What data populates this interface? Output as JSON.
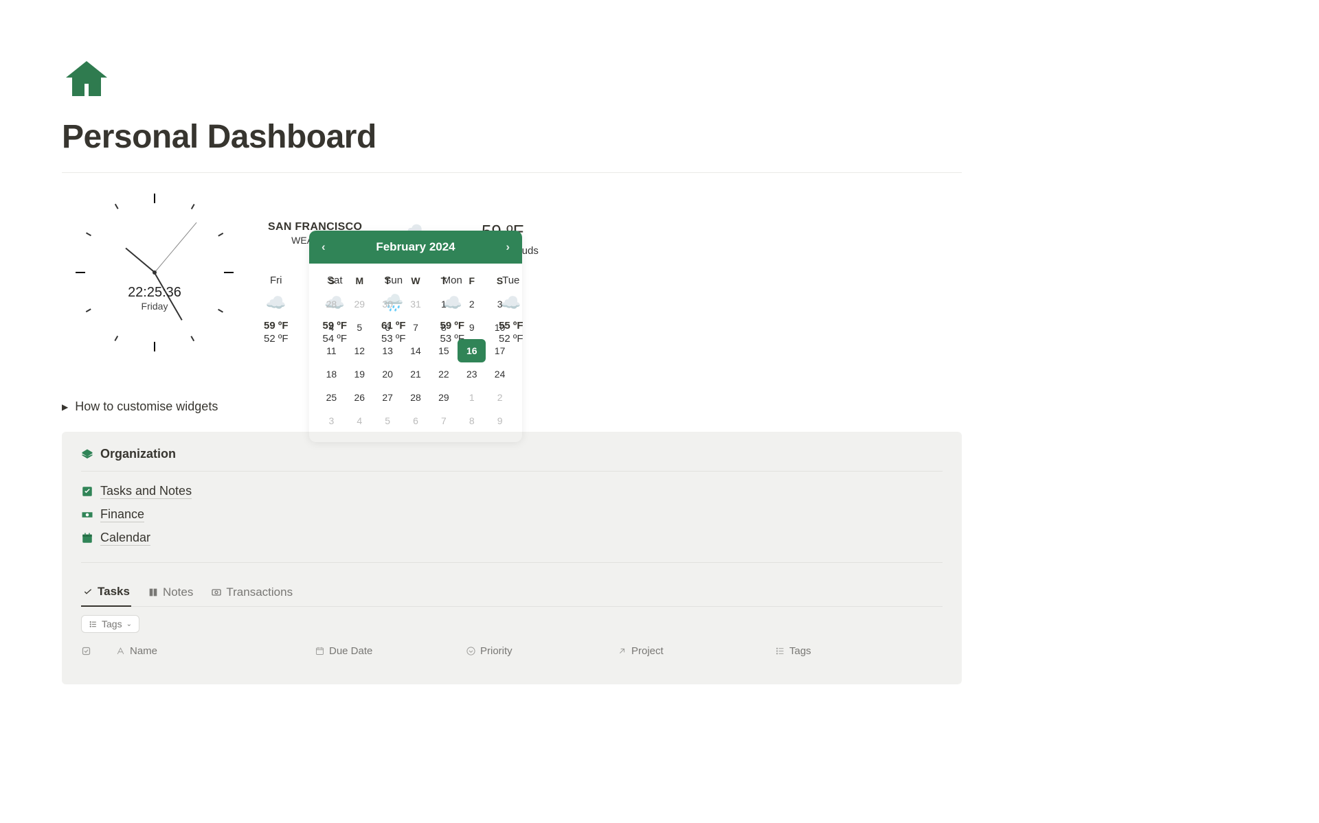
{
  "page": {
    "title": "Personal Dashboard"
  },
  "clock": {
    "time": "22:25:36",
    "day": "Friday"
  },
  "weather": {
    "city": "SAN FRANCISCO",
    "label": "WEATHER",
    "current_temp": "59 ºF",
    "current_desc": "overcast clouds",
    "forecast": [
      {
        "day": "Fri",
        "hi": "59 ºF",
        "lo": "52 ºF"
      },
      {
        "day": "Sat",
        "hi": "59 ºF",
        "lo": "54 ºF"
      },
      {
        "day": "Sun",
        "hi": "61 ºF",
        "lo": "53 ºF"
      },
      {
        "day": "Mon",
        "hi": "59 ºF",
        "lo": "53 ºF"
      },
      {
        "day": "Tue",
        "hi": "55 ºF",
        "lo": "52 ºF"
      }
    ]
  },
  "calendar": {
    "month_label": "February 2024",
    "dow": [
      "S",
      "M",
      "T",
      "W",
      "T",
      "F",
      "S"
    ],
    "today": 16,
    "weeks": [
      [
        {
          "d": 28,
          "m": 1
        },
        {
          "d": 29,
          "m": 1
        },
        {
          "d": 30,
          "m": 1
        },
        {
          "d": 31,
          "m": 1
        },
        {
          "d": 1
        },
        {
          "d": 2
        },
        {
          "d": 3
        }
      ],
      [
        {
          "d": 4
        },
        {
          "d": 5
        },
        {
          "d": 6
        },
        {
          "d": 7
        },
        {
          "d": 8
        },
        {
          "d": 9
        },
        {
          "d": 10
        }
      ],
      [
        {
          "d": 11
        },
        {
          "d": 12
        },
        {
          "d": 13
        },
        {
          "d": 14
        },
        {
          "d": 15
        },
        {
          "d": 16,
          "t": 1
        },
        {
          "d": 17
        }
      ],
      [
        {
          "d": 18
        },
        {
          "d": 19
        },
        {
          "d": 20
        },
        {
          "d": 21
        },
        {
          "d": 22
        },
        {
          "d": 23
        },
        {
          "d": 24
        }
      ],
      [
        {
          "d": 25
        },
        {
          "d": 26
        },
        {
          "d": 27
        },
        {
          "d": 28
        },
        {
          "d": 29
        },
        {
          "d": 1,
          "m": 1
        },
        {
          "d": 2,
          "m": 1
        }
      ],
      [
        {
          "d": 3,
          "m": 1
        },
        {
          "d": 4,
          "m": 1
        },
        {
          "d": 5,
          "m": 1
        },
        {
          "d": 6,
          "m": 1
        },
        {
          "d": 7,
          "m": 1
        },
        {
          "d": 8,
          "m": 1
        },
        {
          "d": 9,
          "m": 1
        }
      ]
    ]
  },
  "disclosure": {
    "label": "How to customise widgets"
  },
  "organization": {
    "title": "Organization",
    "links": [
      "Tasks and Notes",
      "Finance",
      "Calendar"
    ]
  },
  "tabs": {
    "items": [
      "Tasks",
      "Notes",
      "Transactions"
    ],
    "active": 0,
    "filter_chip": "Tags"
  },
  "table": {
    "columns": [
      "Name",
      "Due Date",
      "Priority",
      "Project",
      "Tags"
    ]
  }
}
